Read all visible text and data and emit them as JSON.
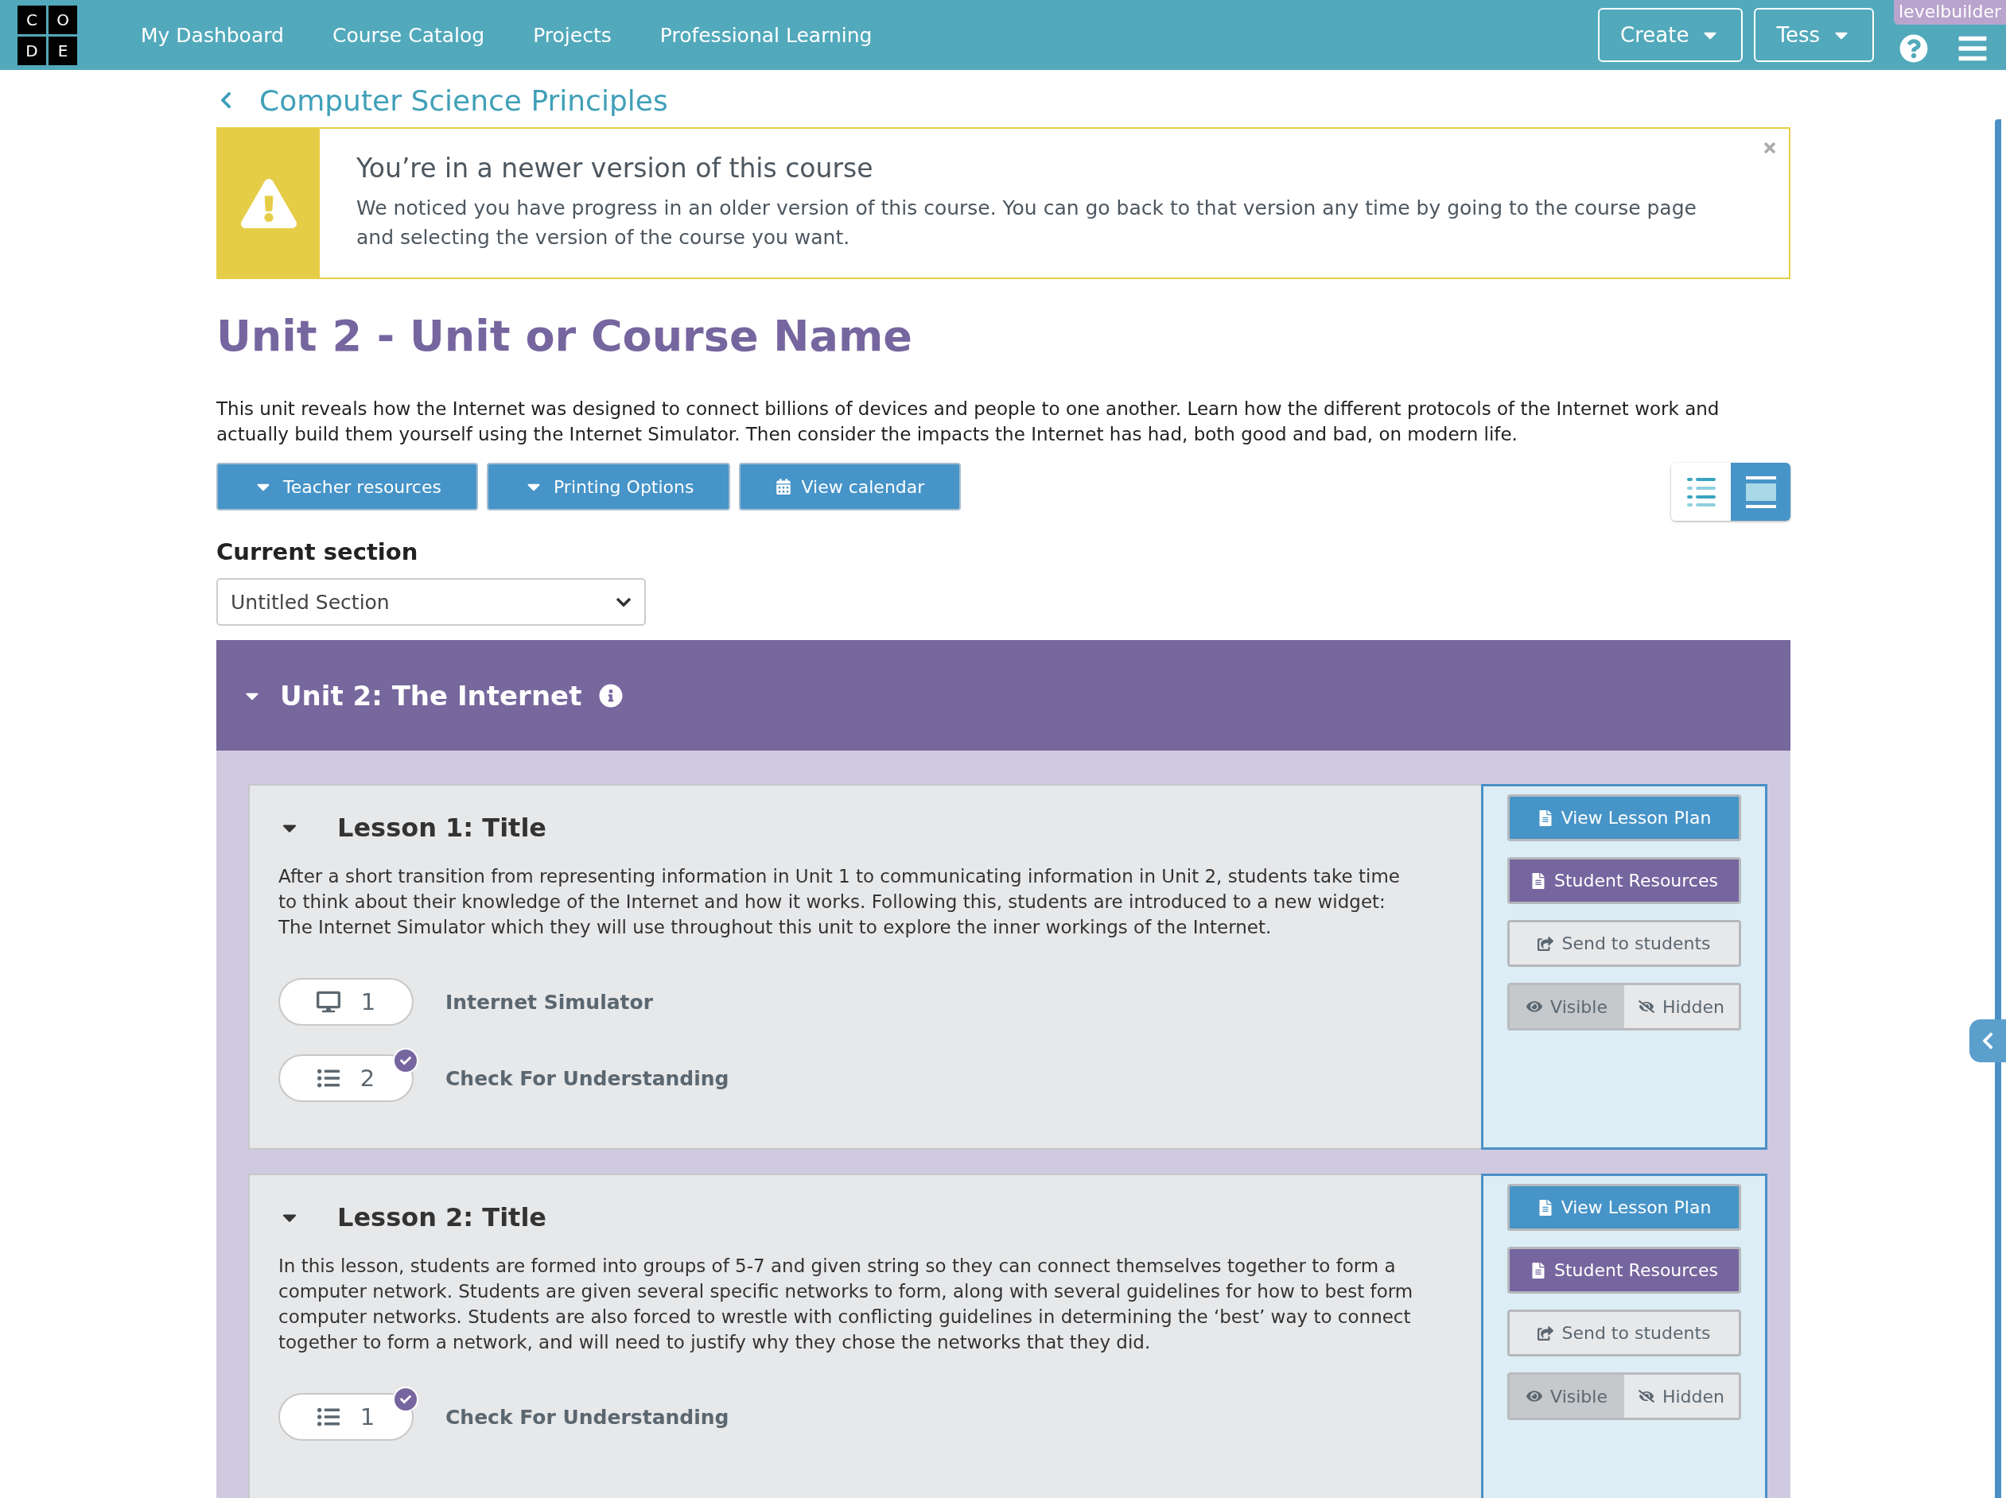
{
  "header": {
    "logo": [
      "C",
      "O",
      "D",
      "E"
    ],
    "nav": [
      "My Dashboard",
      "Course Catalog",
      "Projects",
      "Professional Learning"
    ],
    "menus": [
      "Create",
      "Tess"
    ],
    "badge": "levelbuilder"
  },
  "breadcrumb": "Computer Science Principles",
  "notice": {
    "title": "You’re in a newer version of this course",
    "body": "We noticed you have progress in an older version of this course. You can go back to that version any time by going to the course page and selecting the version of the course you want."
  },
  "unit": {
    "title": "Unit 2 - Unit or Course Name",
    "description": "This unit reveals how the Internet was designed to connect billions of devices and people to one another. Learn how the different protocols of the Internet work and actually build them yourself using the Internet Simulator. Then consider the impacts the Internet has had, both good and bad, on modern life."
  },
  "actions": [
    {
      "kind": "dropdown",
      "label": "Teacher resources"
    },
    {
      "kind": "dropdown",
      "label": "Printing Options"
    },
    {
      "kind": "calendar",
      "label": "View calendar"
    }
  ],
  "view_toggle": [
    {
      "kind": "list",
      "selected": false
    },
    {
      "kind": "detail",
      "selected": true
    }
  ],
  "section": {
    "label": "Current section",
    "value": "Untitled Section"
  },
  "unit_group": {
    "title": "Unit 2: The Internet",
    "expanded": true
  },
  "lessons": [
    {
      "title": "Lesson 1: Title",
      "expanded": true,
      "description": "After a short transition from representing information in Unit 1 to communicating information in Unit 2, students take time to think about their knowledge of the Internet and how it works. Following this, students are introduced to a new widget: The Internet Simulator which they will use throughout this unit to explore the inner workings of the Internet.",
      "levels": [
        {
          "kind": "simulator",
          "number": "1",
          "name": "Internet Simulator",
          "completed": false
        },
        {
          "kind": "assessment",
          "number": "2",
          "name": "Check For Understanding",
          "completed": true
        }
      ],
      "buttons": [
        {
          "kind": "lesson_plan",
          "label": "View Lesson Plan"
        },
        {
          "kind": "student_resources",
          "label": "Student Resources"
        },
        {
          "kind": "send",
          "label": "Send to students"
        }
      ],
      "visibility": [
        {
          "kind": "visible",
          "label": "Visible",
          "selected": true
        },
        {
          "kind": "hidden",
          "label": "Hidden",
          "selected": false
        }
      ]
    },
    {
      "title": "Lesson 2: Title",
      "expanded": true,
      "description": "In this lesson, students are formed into groups of 5-7 and given string so they can connect themselves together to form a computer network. Students are given several specific networks to form, along with several guidelines for how to best form computer networks. Students are also forced to wrestle with conflicting guidelines in determining the ‘best’ way to connect together to form a network, and will need to justify why they chose the networks that they did.",
      "levels": [
        {
          "kind": "assessment",
          "number": "1",
          "name": "Check For Understanding",
          "completed": true
        }
      ],
      "buttons": [
        {
          "kind": "lesson_plan",
          "label": "View Lesson Plan"
        },
        {
          "kind": "student_resources",
          "label": "Student Resources"
        },
        {
          "kind": "send",
          "label": "Send to students"
        }
      ],
      "visibility": [
        {
          "kind": "visible",
          "label": "Visible",
          "selected": true
        },
        {
          "kind": "hidden",
          "label": "Hidden",
          "selected": false
        }
      ]
    }
  ]
}
